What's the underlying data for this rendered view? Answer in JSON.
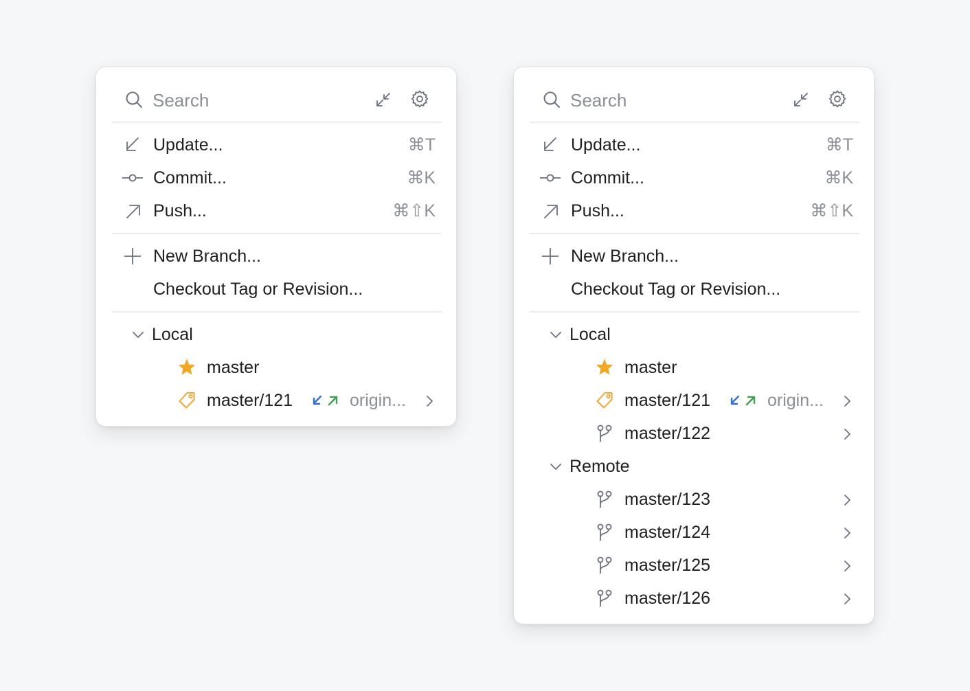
{
  "colors": {
    "background": "#f6f7f9",
    "panel": "#ffffff",
    "text": "#1f1f1f",
    "muted": "#8c8f96",
    "icon": "#6c707e",
    "star": "#f5a623",
    "tag": "#f0a732",
    "incoming": "#2f6fde",
    "outgoing": "#3f9f52"
  },
  "left_popup": {
    "search": {
      "placeholder": "Search"
    },
    "actions": [
      {
        "icon": "arrow-down-left-icon",
        "label": "Update...",
        "shortcut": "⌘T"
      },
      {
        "icon": "commit-icon",
        "label": "Commit...",
        "shortcut": "⌘K"
      },
      {
        "icon": "arrow-up-right-icon",
        "label": "Push...",
        "shortcut": "⌘⇧K"
      }
    ],
    "branch_actions": [
      {
        "icon": "plus-icon",
        "label": "New Branch..."
      },
      {
        "icon": "",
        "label": "Checkout Tag or Revision..."
      }
    ],
    "local": {
      "label": "Local",
      "branches": [
        {
          "icon": "star-icon",
          "name": "master"
        },
        {
          "icon": "tag-icon",
          "name": "master/121",
          "remote": "origin..."
        }
      ]
    }
  },
  "right_popup": {
    "search": {
      "placeholder": "Search"
    },
    "actions": [
      {
        "icon": "arrow-down-left-icon",
        "label": "Update...",
        "shortcut": "⌘T"
      },
      {
        "icon": "commit-icon",
        "label": "Commit...",
        "shortcut": "⌘K"
      },
      {
        "icon": "arrow-up-right-icon",
        "label": "Push...",
        "shortcut": "⌘⇧K"
      }
    ],
    "branch_actions": [
      {
        "icon": "plus-icon",
        "label": "New Branch..."
      },
      {
        "icon": "",
        "label": "Checkout Tag or Revision..."
      }
    ],
    "local": {
      "label": "Local",
      "branches": [
        {
          "icon": "star-icon",
          "name": "master"
        },
        {
          "icon": "tag-icon",
          "name": "master/121",
          "remote": "origin..."
        },
        {
          "icon": "branch-icon",
          "name": "master/122"
        }
      ]
    },
    "remote": {
      "label": "Remote",
      "branches": [
        {
          "icon": "branch-icon",
          "name": "master/123"
        },
        {
          "icon": "branch-icon",
          "name": "master/124"
        },
        {
          "icon": "branch-icon",
          "name": "master/125"
        },
        {
          "icon": "branch-icon",
          "name": "master/126"
        }
      ]
    }
  }
}
